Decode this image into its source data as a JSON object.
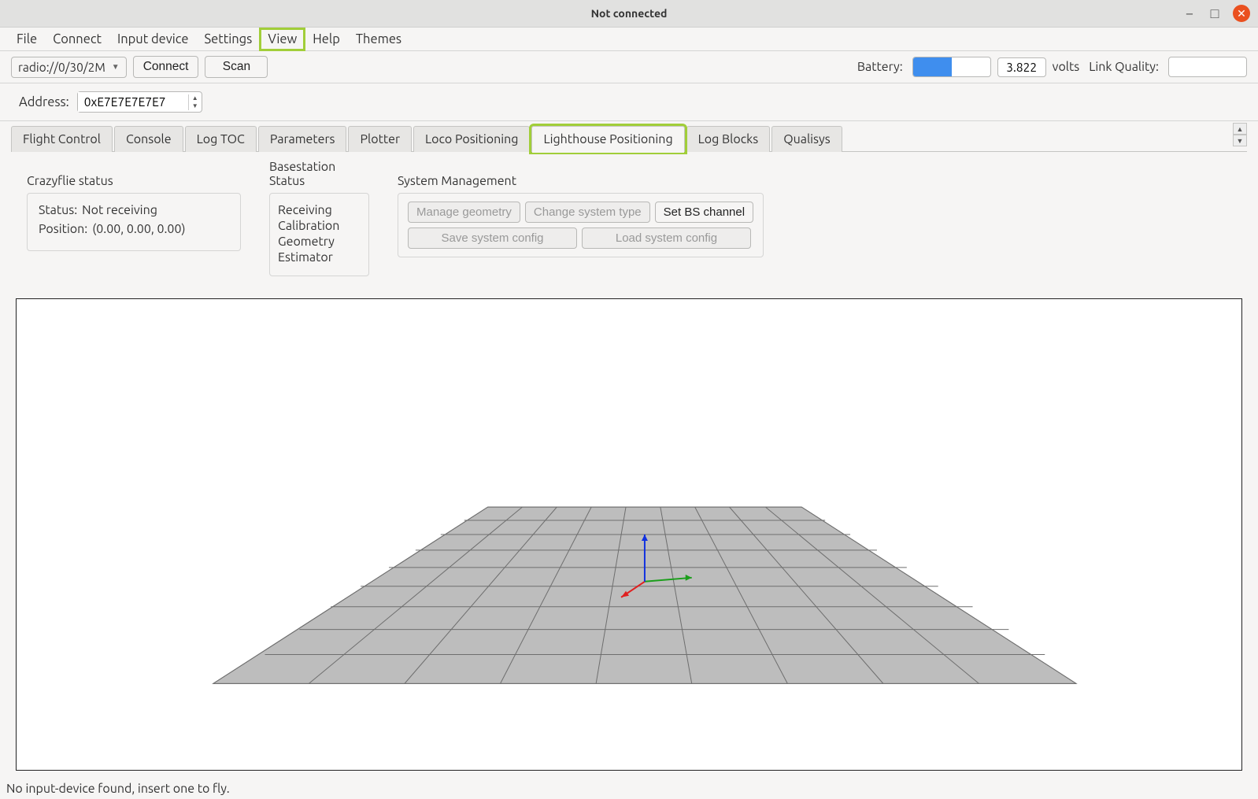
{
  "window": {
    "title": "Not connected"
  },
  "menubar": {
    "items": [
      "File",
      "Connect",
      "Input device",
      "Settings",
      "View",
      "Help",
      "Themes"
    ],
    "highlighted_index": 4
  },
  "toolbar": {
    "uri": "radio://0/30/2M",
    "connect_label": "Connect",
    "scan_label": "Scan",
    "battery_label": "Battery:",
    "battery_value": "3.822",
    "battery_percent": 50,
    "volts_label": "volts",
    "link_quality_label": "Link Quality:"
  },
  "address": {
    "label": "Address:",
    "value": "0xE7E7E7E7E7"
  },
  "tabs": {
    "items": [
      "Flight Control",
      "Console",
      "Log TOC",
      "Parameters",
      "Plotter",
      "Loco Positioning",
      "Lighthouse Positioning",
      "Log Blocks",
      "Qualisys"
    ],
    "active_index": 6,
    "highlighted_index": 6
  },
  "crazyflie_status": {
    "title": "Crazyflie status",
    "status_label": "Status:",
    "status_value": "Not receiving",
    "position_label": "Position:",
    "position_value": "(0.00, 0.00, 0.00)"
  },
  "basestation_status": {
    "title": "Basestation Status",
    "items": [
      "Receiving",
      "Calibration",
      "Geometry",
      "Estimator"
    ]
  },
  "system_management": {
    "title": "System Management",
    "manage_geometry": "Manage geometry",
    "change_system_type": "Change system type",
    "set_bs_channel": "Set BS channel",
    "save_config": "Save system config",
    "load_config": "Load system config"
  },
  "statusbar": {
    "text": "No input-device found, insert one to fly."
  }
}
